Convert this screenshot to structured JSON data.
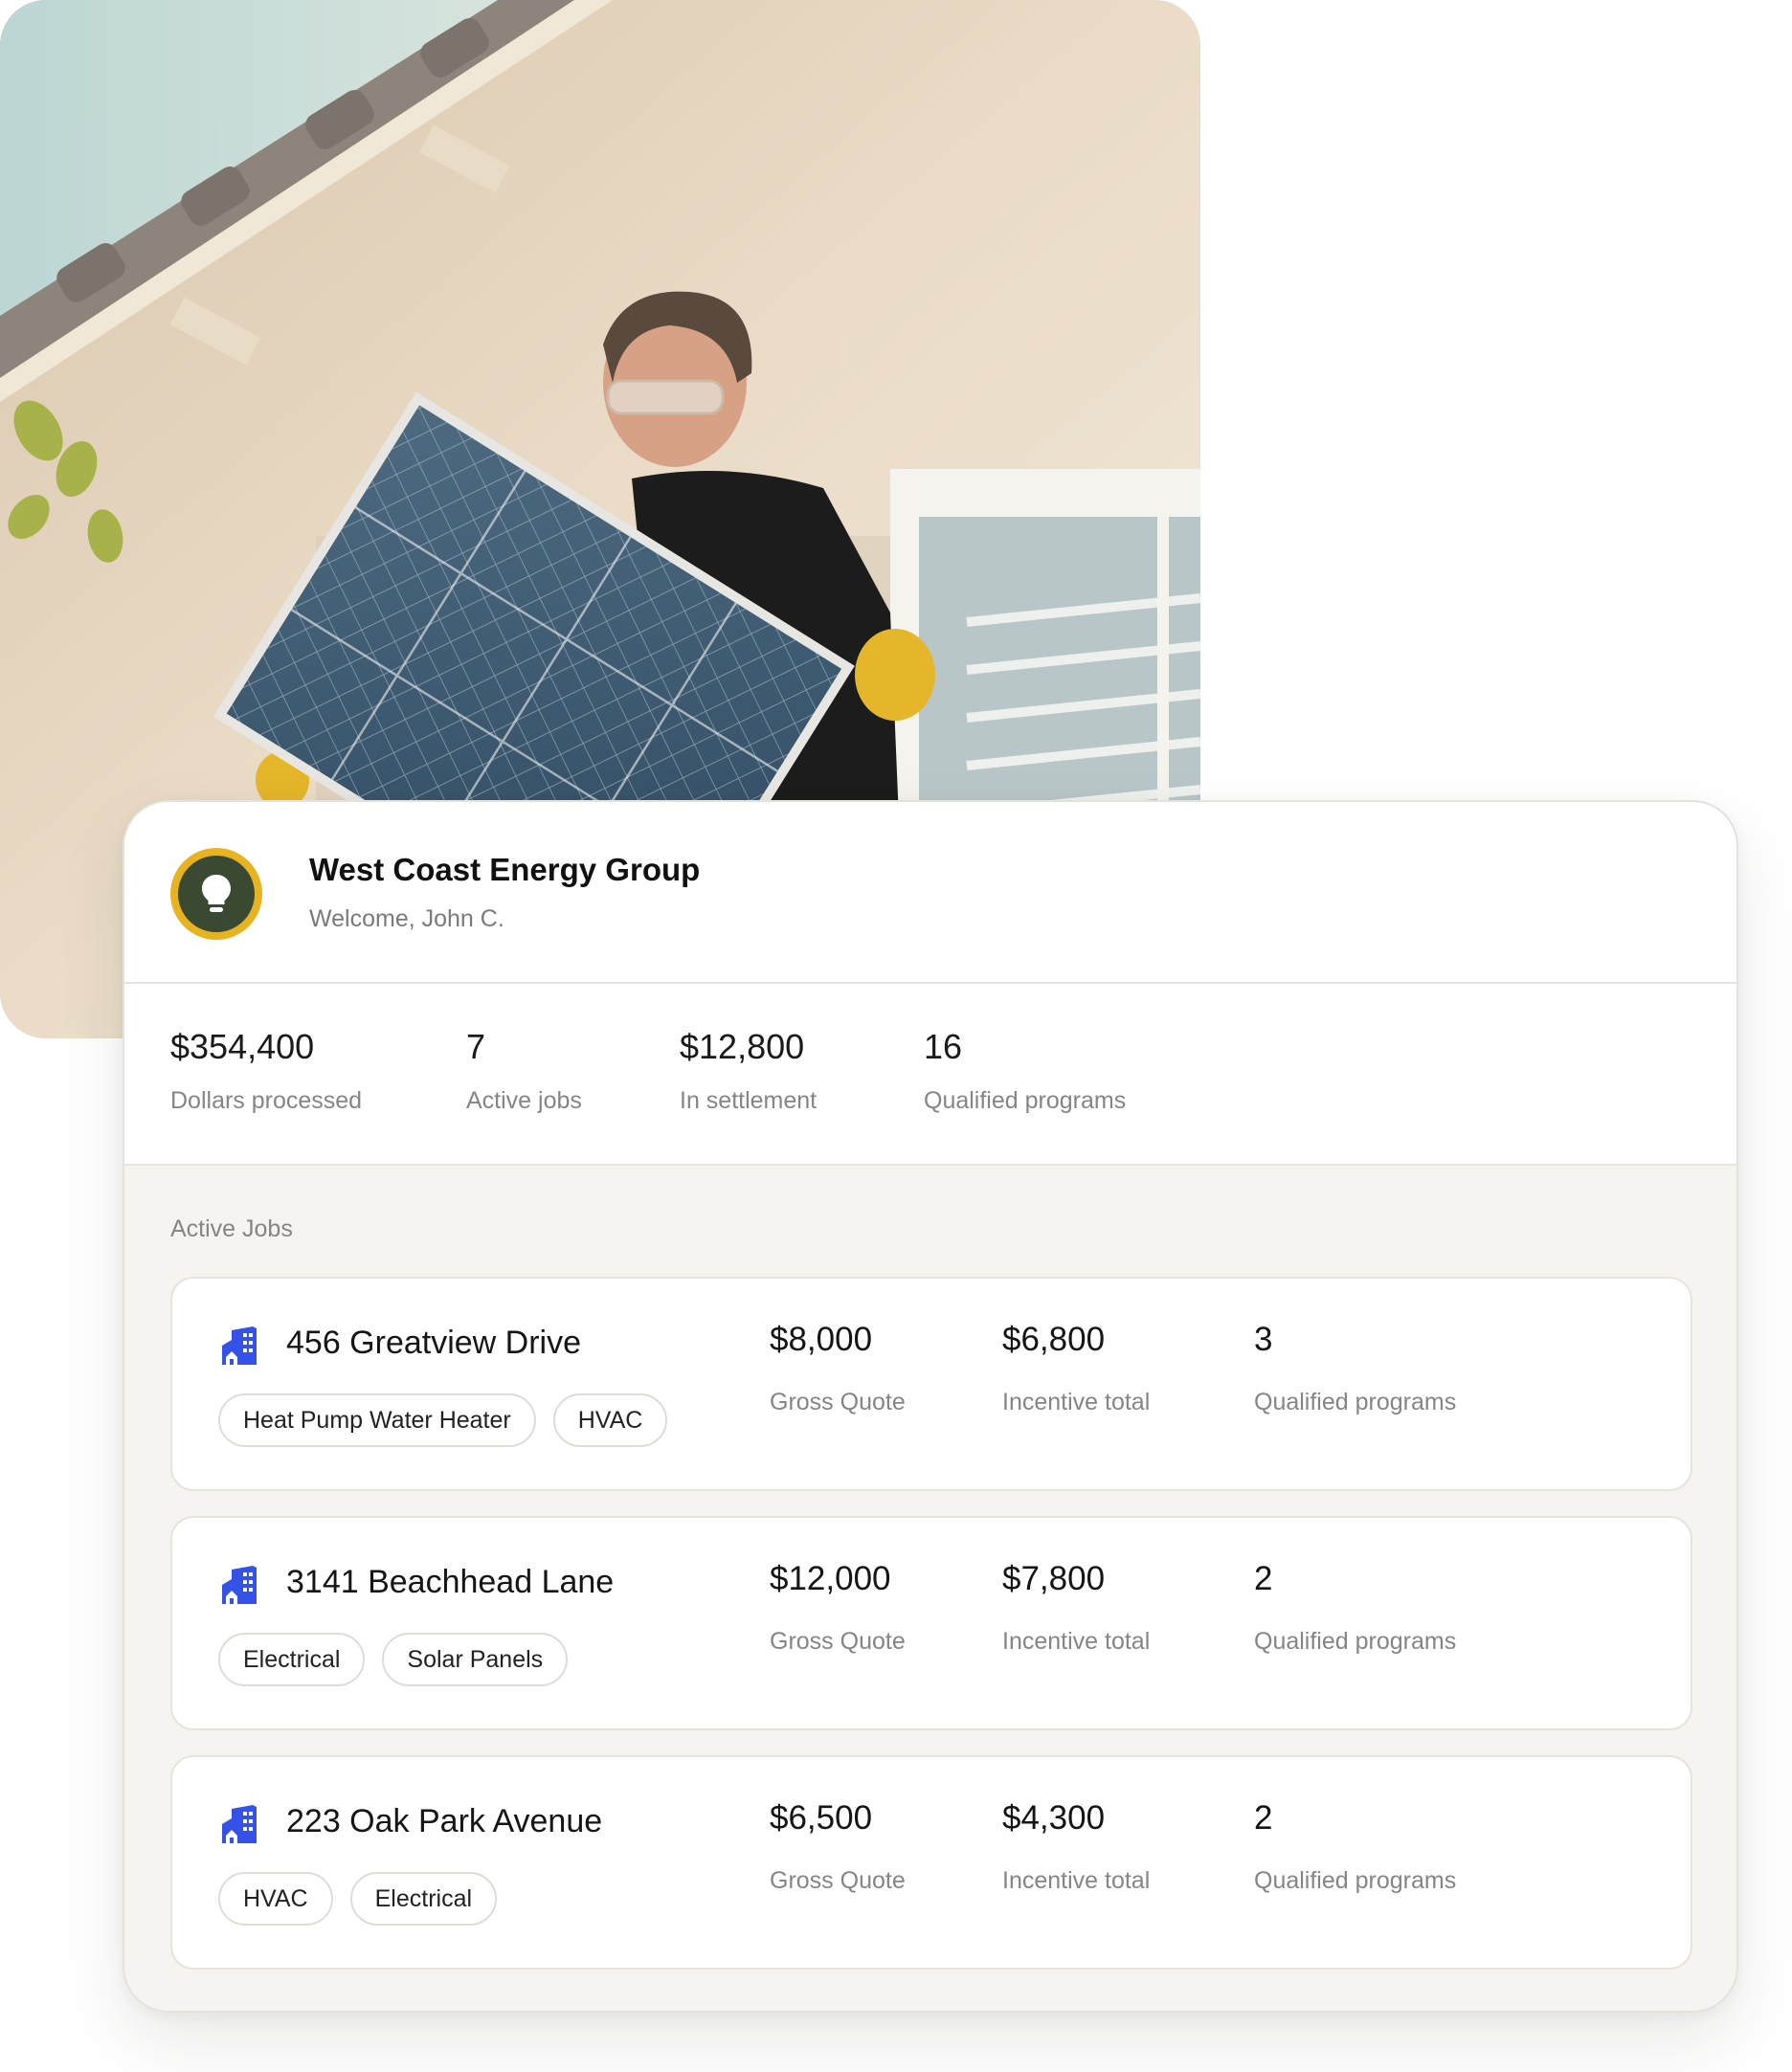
{
  "company": {
    "name": "West Coast Energy Group",
    "welcome": "Welcome, John C.",
    "logo_icon": "lightbulb-icon",
    "logo_ring_color": "#e8b320",
    "logo_fill_color": "#3a4a32"
  },
  "stats": [
    {
      "value": "$354,400",
      "label": "Dollars processed"
    },
    {
      "value": "7",
      "label": "Active jobs"
    },
    {
      "value": "$12,800",
      "label": "In settlement"
    },
    {
      "value": "16",
      "label": "Qualified programs"
    }
  ],
  "active_jobs": {
    "title": "Active Jobs",
    "icon": "building-icon",
    "icon_color": "#3552e8",
    "items": [
      {
        "address": "456 Greatview Drive",
        "tags": [
          "Heat Pump Water Heater",
          "HVAC"
        ],
        "gross_quote": "$8,000",
        "gross_quote_label": "Gross Quote",
        "incentive_total": "$6,800",
        "incentive_total_label": "Incentive total",
        "qualified_programs": "3",
        "qualified_programs_label": "Qualified programs"
      },
      {
        "address": "3141 Beachhead Lane",
        "tags": [
          "Electrical",
          "Solar Panels"
        ],
        "gross_quote": "$12,000",
        "gross_quote_label": "Gross Quote",
        "incentive_total": "$7,800",
        "incentive_total_label": "Incentive total",
        "qualified_programs": "2",
        "qualified_programs_label": "Qualified programs"
      },
      {
        "address": "223 Oak Park Avenue",
        "tags": [
          "HVAC",
          "Electrical"
        ],
        "gross_quote": "$6,500",
        "gross_quote_label": "Gross Quote",
        "incentive_total": "$4,300",
        "incentive_total_label": "Incentive total",
        "qualified_programs": "2",
        "qualified_programs_label": "Qualified programs"
      }
    ]
  }
}
